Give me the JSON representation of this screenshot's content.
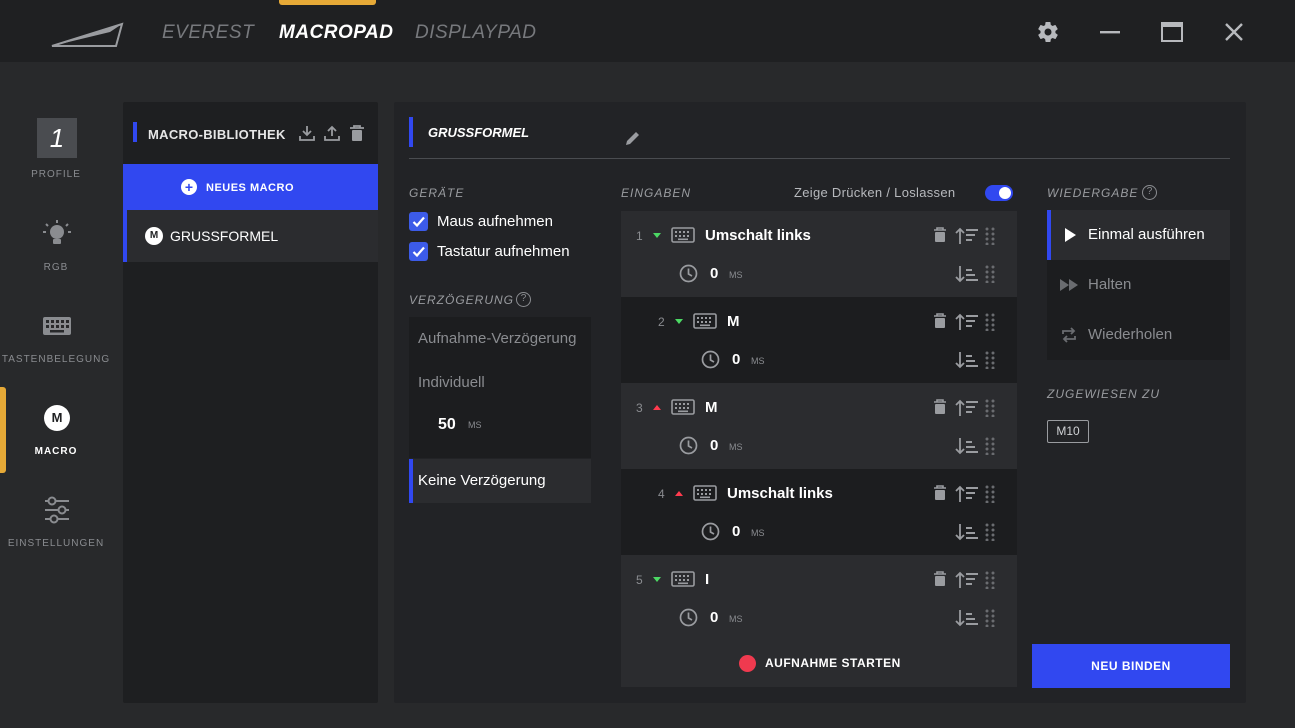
{
  "topbar": {
    "tabs": [
      "EVEREST",
      "MACROPAD",
      "DISPLAYPAD"
    ],
    "active_tab": "MACROPAD"
  },
  "nav": {
    "profile_number": "1",
    "items": [
      {
        "label": "PROFILE",
        "icon": "profile-number"
      },
      {
        "label": "RGB",
        "icon": "bulb-icon"
      },
      {
        "label": "TASTENBELEGUNG",
        "icon": "keyboard-icon"
      },
      {
        "label": "MACRO",
        "icon": "macro-icon"
      },
      {
        "label": "EINSTELLUNGEN",
        "icon": "sliders-icon"
      }
    ],
    "active": "MACRO",
    "macro_letter": "M"
  },
  "library": {
    "title": "MACRO-BIBLIOTHEK",
    "new_macro": "NEUES MACRO",
    "items": [
      {
        "letter": "M",
        "name": "GRUSSFORMEL"
      }
    ]
  },
  "macro": {
    "name": "GRUSSFORMEL"
  },
  "devices": {
    "title": "GERÄTE",
    "options": [
      "Maus aufnehmen",
      "Tastatur aufnehmen"
    ]
  },
  "delay": {
    "title": "VERZÖGERUNG",
    "options": [
      "Aufnahme-Verzögerung",
      "Individuell",
      "Keine Verzögerung"
    ],
    "custom_value": "50",
    "custom_unit": "MS",
    "selected": "Keine Verzögerung"
  },
  "inputs": {
    "title": "EINGABEN",
    "toggle_label": "Zeige Drücken / Loslassen",
    "toggle_on": true,
    "rows": [
      {
        "num": "1",
        "direction": "down",
        "key": "Umschalt links",
        "delay": "0",
        "unit": "MS"
      },
      {
        "num": "2",
        "direction": "down",
        "key": "M",
        "delay": "0",
        "unit": "MS"
      },
      {
        "num": "3",
        "direction": "up",
        "key": "M",
        "delay": "0",
        "unit": "MS"
      },
      {
        "num": "4",
        "direction": "up",
        "key": "Umschalt links",
        "delay": "0",
        "unit": "MS"
      },
      {
        "num": "5",
        "direction": "down",
        "key": "I",
        "delay": "0",
        "unit": "MS"
      }
    ],
    "record_label": "AUFNAHME STARTEN"
  },
  "playback": {
    "title": "WIEDERGABE",
    "options": [
      "Einmal ausführen",
      "Halten",
      "Wiederholen"
    ],
    "selected": "Einmal ausführen"
  },
  "assigned": {
    "title": "ZUGEWIESEN ZU",
    "key": "M10"
  },
  "rebind_label": "NEU BINDEN",
  "colors": {
    "accent_blue": "#3148f0",
    "accent_gold": "#e6a937",
    "down_arrow": "#4cd964",
    "up_arrow": "#ff3b4e",
    "record_dot": "#ef3a4f"
  }
}
